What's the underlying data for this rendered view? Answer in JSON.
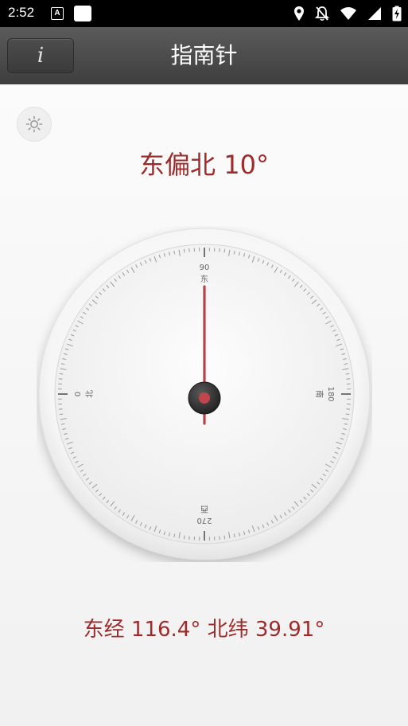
{
  "status_bar": {
    "time": "2:52",
    "notification_letter": "A",
    "icons": [
      "location-icon",
      "notifications-off-icon",
      "wifi-icon",
      "cellular-icon",
      "battery-charging-icon"
    ]
  },
  "app_bar": {
    "info_label": "i",
    "title": "指南针"
  },
  "compass": {
    "heading_text": "东偏北 10°",
    "coordinates_text": "东经 116.4° 北纬 39.91°",
    "dial_rotation_deg": -90,
    "needle_deg": 0,
    "cardinals": [
      {
        "deg": 0,
        "label": "北"
      },
      {
        "deg": 90,
        "label": "东"
      },
      {
        "deg": 180,
        "label": "南"
      },
      {
        "deg": 270,
        "label": "西"
      }
    ],
    "accent_color": "#9e2b2b",
    "needle_color": "#b8424a"
  }
}
